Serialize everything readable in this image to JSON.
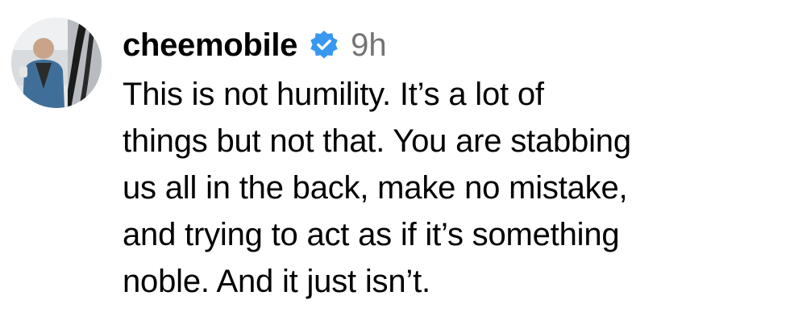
{
  "comment": {
    "avatar_icon": "user-avatar-photo",
    "username": "cheemobile",
    "verified_icon": "verified-badge-icon",
    "verified_color": "#3897f0",
    "timestamp": "9h",
    "timestamp_color": "#737373",
    "text": "This is not humility. It’s a lot of\nthings but not that. You are stabbing\nus all in the back, make no mistake,\nand trying to act as if it’s something\nnoble. And it just isn’t."
  }
}
